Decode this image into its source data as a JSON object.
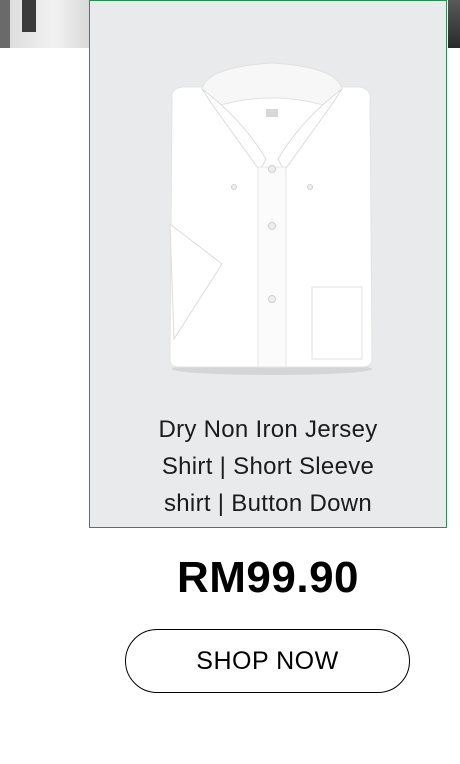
{
  "product": {
    "name_lines": [
      "Dry Non Iron Jersey",
      "Shirt | Short Sleeve",
      "shirt | Button Down"
    ],
    "price": "RM99.90",
    "image_icon": "folded-white-shirt"
  },
  "cta": {
    "label": "SHOP NOW"
  },
  "colors": {
    "card_bg": "#e9eaeb",
    "card_border": "#2e8b57",
    "text": "#000000"
  }
}
